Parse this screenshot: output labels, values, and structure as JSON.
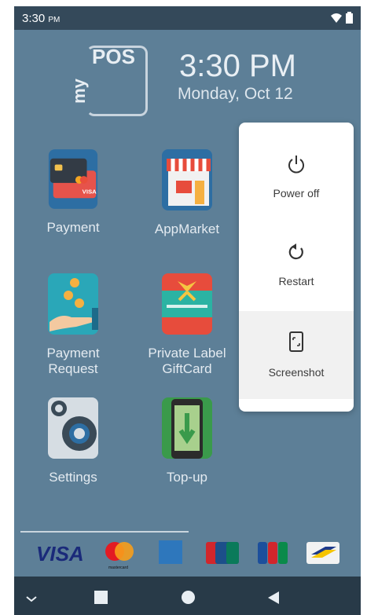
{
  "status": {
    "time": "3:30",
    "ampm": "PM"
  },
  "header": {
    "logo_top": "POS",
    "logo_side": "my",
    "clock": "3:30 PM",
    "date": "Monday, Oct 12"
  },
  "apps": [
    {
      "label": "Payment"
    },
    {
      "label": "AppMarket"
    },
    {
      "label_line1": "Payment",
      "label_line2": "Request"
    },
    {
      "label_line1": "Private Label",
      "label_line2": "GiftCard"
    },
    {
      "label": "Settings"
    },
    {
      "label": "Top-up"
    }
  ],
  "power_menu": {
    "items": [
      {
        "label": "Power off",
        "icon": "power-icon"
      },
      {
        "label": "Restart",
        "icon": "restart-icon"
      },
      {
        "label": "Screenshot",
        "icon": "screenshot-icon"
      }
    ]
  },
  "cards": [
    {
      "label": "VISA"
    },
    {
      "label": "mastercard"
    },
    {
      "label": "American Express"
    },
    {
      "label": "UnionPay"
    },
    {
      "label": "JCB"
    },
    {
      "label": "Bancontact"
    }
  ],
  "colors": {
    "wallpaper": "#5d7f97",
    "statusbar": "#34495a",
    "navbar": "#283a48",
    "menu_bg": "#ffffff"
  }
}
